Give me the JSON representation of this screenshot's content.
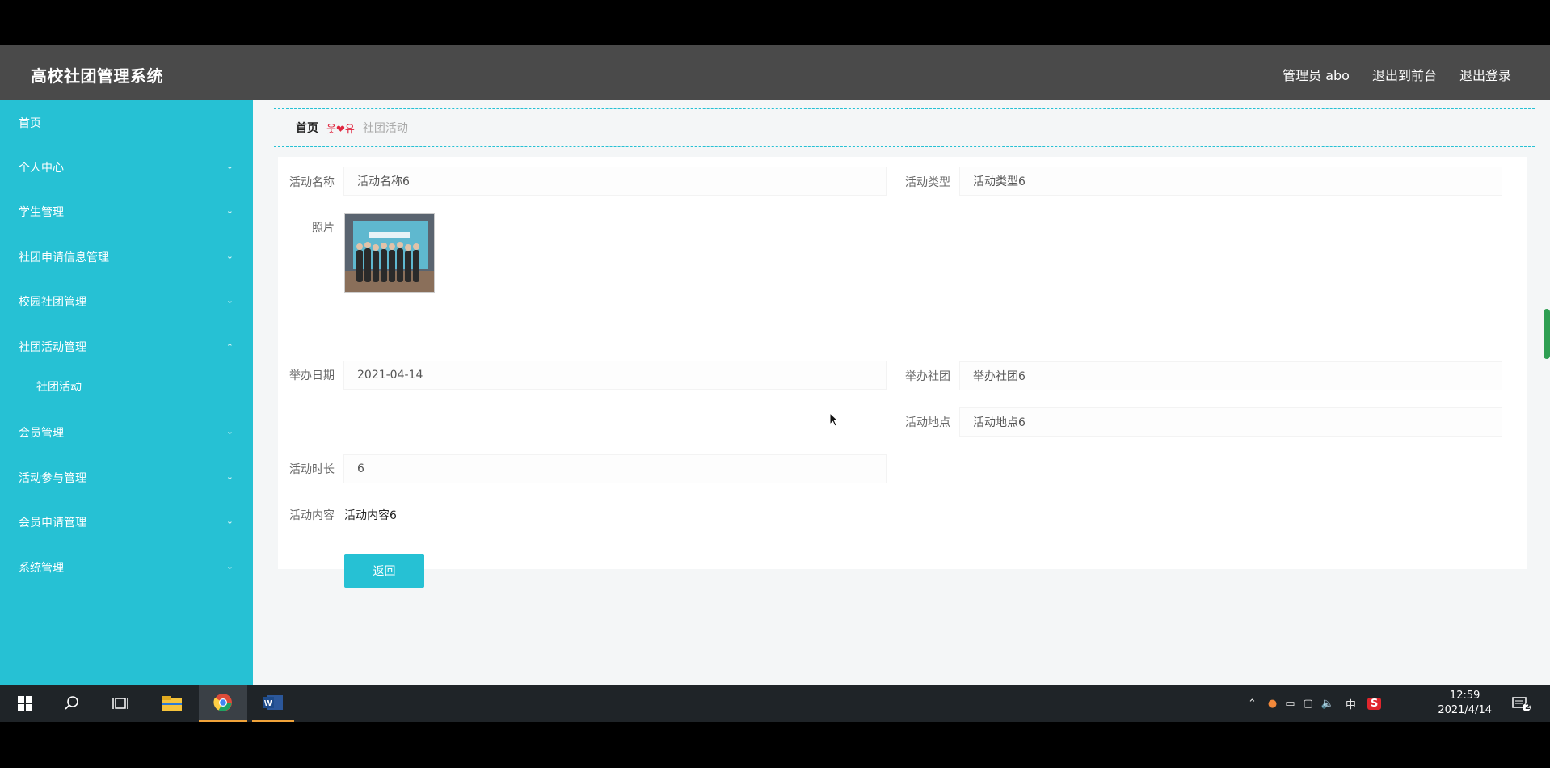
{
  "header": {
    "title": "高校社团管理系统",
    "user_label": "管理员 abo",
    "back_to_front": "退出到前台",
    "logout": "退出登录"
  },
  "sidebar": {
    "items": [
      {
        "label": "首页"
      },
      {
        "label": "个人中心"
      },
      {
        "label": "学生管理"
      },
      {
        "label": "社团申请信息管理"
      },
      {
        "label": "校园社团管理"
      },
      {
        "label": "社团活动管理"
      },
      {
        "label": "社团活动"
      },
      {
        "label": "会员管理"
      },
      {
        "label": "活动参与管理"
      },
      {
        "label": "会员申请管理"
      },
      {
        "label": "系统管理"
      }
    ]
  },
  "breadcrumb": {
    "home": "首页",
    "separator": "웃❤유",
    "current": "社团活动"
  },
  "form": {
    "activity_name_label": "活动名称",
    "activity_name_value": "活动名称6",
    "activity_type_label": "活动类型",
    "activity_type_value": "活动类型6",
    "photo_label": "照片",
    "date_label": "举办日期",
    "date_value": "2021-04-14",
    "club_label": "举办社团",
    "club_value": "举办社团6",
    "location_label": "活动地点",
    "location_value": "活动地点6",
    "duration_label": "活动时长",
    "duration_value": "6",
    "content_label": "活动内容",
    "content_value": "活动内容6",
    "return_button": "返回"
  },
  "taskbar": {
    "time": "12:59",
    "date": "2021/4/14",
    "ime": "中",
    "notification_count": "2",
    "icons": [
      "windows-start-icon",
      "search-icon",
      "task-view-icon",
      "file-explorer-icon",
      "chrome-icon",
      "word-icon"
    ]
  },
  "colors": {
    "accent": "#26c1d4",
    "header_bg": "#4a4a4a",
    "taskbar_bg": "#1f2428",
    "separator_red": "#e0263f"
  }
}
